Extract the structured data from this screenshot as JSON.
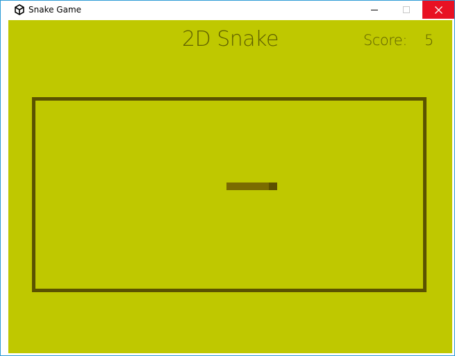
{
  "window": {
    "title": "Snake Game",
    "icon": "unity-icon",
    "buttons": [
      "minimize-icon",
      "maximize-icon",
      "close-icon"
    ],
    "close_color": "#e81123"
  },
  "game": {
    "title": "2D Snake",
    "score_label": "Score:",
    "score_value": "5",
    "background_color": "#bfc800",
    "text_color": "#5e5f00",
    "border_color": "#5a5200",
    "snake": {
      "length_segments": 6,
      "direction": "right",
      "body_color": "#7a6b00",
      "head_color": "#5c5000"
    }
  }
}
